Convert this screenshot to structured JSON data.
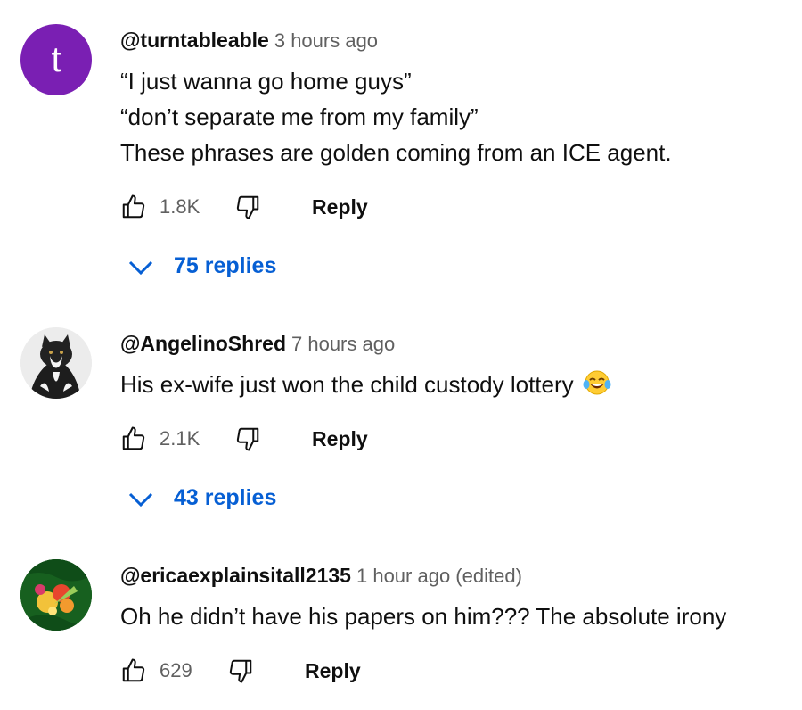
{
  "comments": [
    {
      "author": "@turntableable",
      "time": "3 hours ago",
      "avatar_letter": "t",
      "lines": [
        "“I just wanna go home guys”",
        "“don’t separate me from my family”",
        "These phrases are golden coming from an ICE agent."
      ],
      "likes": "1.8K",
      "reply_label": "Reply",
      "replies_label": "75 replies"
    },
    {
      "author": "@AngelinoShred",
      "time": "7 hours ago",
      "lines": [
        "His ex-wife just won the child custody lottery"
      ],
      "emoji": "face-with-tears-of-joy",
      "likes": "2.1K",
      "reply_label": "Reply",
      "replies_label": "43 replies"
    },
    {
      "author": "@ericaexplainsitall2135",
      "time": "1 hour ago (edited)",
      "lines": [
        "Oh he didn’t have his papers on him???  The absolute irony"
      ],
      "likes": "629",
      "reply_label": "Reply"
    }
  ],
  "colors": {
    "link": "#065fd4",
    "meta": "#606060",
    "text": "#0f0f0f",
    "avatar_t": "#7a1fb3"
  }
}
